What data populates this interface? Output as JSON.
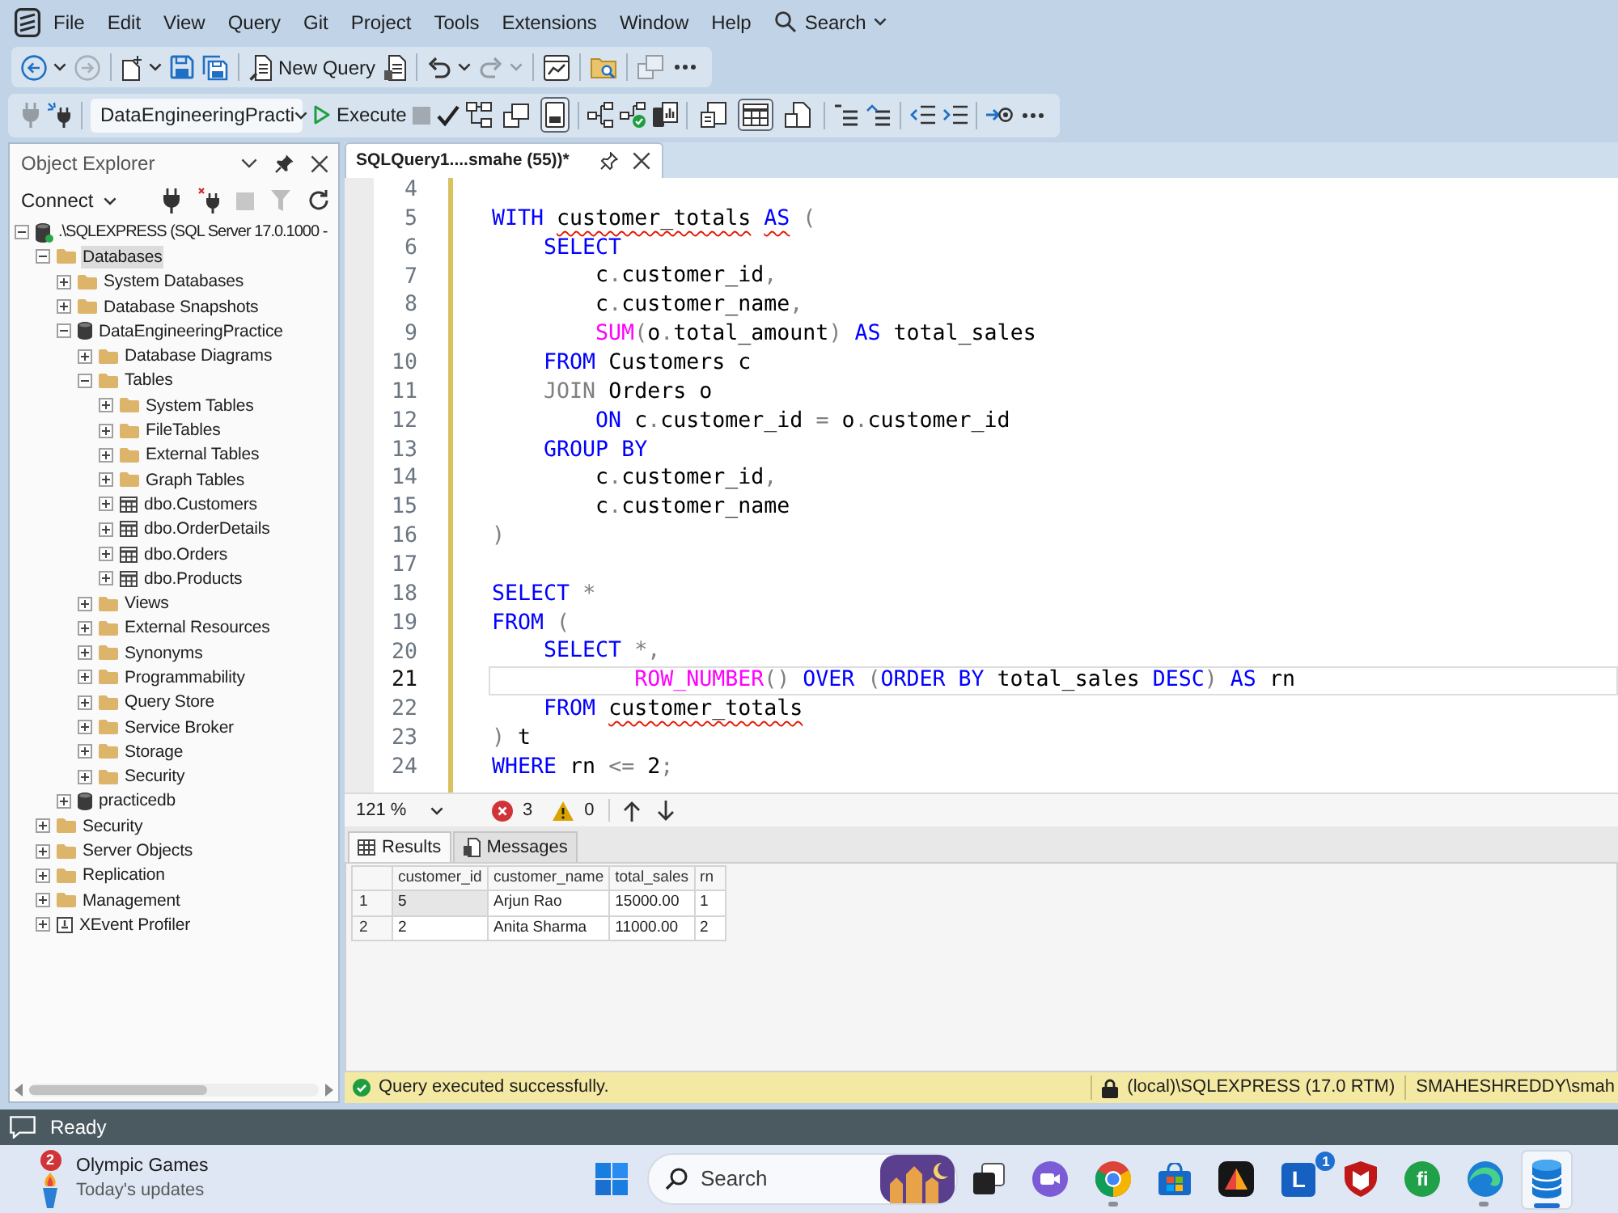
{
  "menu_bar": {
    "items": [
      "File",
      "Edit",
      "View",
      "Query",
      "Git",
      "Project",
      "Tools",
      "Extensions",
      "Window",
      "Help"
    ],
    "search": "Search"
  },
  "standard_toolbar": [
    {
      "kind": "split",
      "disabled": false
    },
    {
      "kind": "button",
      "disabled": true
    },
    {
      "kind": "separator"
    },
    {
      "kind": "split",
      "disabled": false
    },
    {
      "kind": "button",
      "disabled": false
    },
    {
      "kind": "button",
      "disabled": false
    },
    {
      "kind": "separator"
    },
    {
      "kind": "labeled",
      "label": "New Query",
      "disabled": false
    },
    {
      "kind": "button",
      "disabled": false
    },
    {
      "kind": "separator"
    },
    {
      "kind": "split",
      "disabled": false
    },
    {
      "kind": "split",
      "disabled": true
    },
    {
      "kind": "separator"
    },
    {
      "kind": "button",
      "disabled": false
    },
    {
      "kind": "separator"
    },
    {
      "kind": "button",
      "disabled": false
    },
    {
      "kind": "separator"
    },
    {
      "kind": "button",
      "disabled": true
    },
    {
      "kind": "overflow"
    }
  ],
  "sql_toolbar": [
    {
      "kind": "button",
      "disabled": true
    },
    {
      "kind": "button",
      "disabled": false
    },
    {
      "kind": "separator"
    },
    {
      "kind": "combo",
      "value": "DataEngineeringPracti"
    },
    {
      "kind": "labeled",
      "label": "Execute",
      "disabled": false
    },
    {
      "kind": "button",
      "disabled": true
    },
    {
      "kind": "button",
      "disabled": false
    },
    {
      "kind": "button",
      "disabled": false
    },
    {
      "kind": "toggle",
      "on": false,
      "disabled": false
    },
    {
      "kind": "toggle",
      "on": true,
      "disabled": false
    },
    {
      "kind": "separator"
    },
    {
      "kind": "button",
      "disabled": false
    },
    {
      "kind": "button",
      "disabled": false
    },
    {
      "kind": "button",
      "disabled": false
    },
    {
      "kind": "separator"
    },
    {
      "kind": "toggle",
      "on": false,
      "disabled": false
    },
    {
      "kind": "toggle",
      "on": true,
      "disabled": false
    },
    {
      "kind": "toggle",
      "on": false,
      "disabled": false
    },
    {
      "kind": "separator"
    },
    {
      "kind": "button",
      "disabled": false
    },
    {
      "kind": "button",
      "disabled": false
    },
    {
      "kind": "separator"
    },
    {
      "kind": "button",
      "disabled": false
    },
    {
      "kind": "button",
      "disabled": false
    },
    {
      "kind": "separator"
    },
    {
      "kind": "button",
      "disabled": false
    },
    {
      "kind": "overflow"
    }
  ],
  "object_explorer": {
    "title": "Object Explorer",
    "connect": "Connect",
    "tools": [
      {
        "disabled": false
      },
      {
        "disabled": false
      },
      {
        "disabled": true
      },
      {
        "disabled": true
      },
      {
        "disabled": false
      }
    ],
    "tree": [
      {
        "label": ".\\SQLEXPRESS (SQL Server 17.0.1000 -",
        "kind": "server",
        "expanded": true,
        "selected": false,
        "children": [
          {
            "label": "Databases",
            "kind": "folder",
            "expanded": true,
            "selected": true,
            "children": [
              {
                "label": "System Databases",
                "kind": "folder",
                "expanded": false,
                "selected": false
              },
              {
                "label": "Database Snapshots",
                "kind": "folder",
                "expanded": false,
                "selected": false
              },
              {
                "label": "DataEngineeringPractice",
                "kind": "database",
                "expanded": true,
                "selected": false,
                "children": [
                  {
                    "label": "Database Diagrams",
                    "kind": "folder",
                    "expanded": false,
                    "selected": false
                  },
                  {
                    "label": "Tables",
                    "kind": "folder",
                    "expanded": true,
                    "selected": false,
                    "children": [
                      {
                        "label": "System Tables",
                        "kind": "folder",
                        "expanded": false,
                        "selected": false
                      },
                      {
                        "label": "FileTables",
                        "kind": "folder",
                        "expanded": false,
                        "selected": false
                      },
                      {
                        "label": "External Tables",
                        "kind": "folder",
                        "expanded": false,
                        "selected": false
                      },
                      {
                        "label": "Graph Tables",
                        "kind": "folder",
                        "expanded": false,
                        "selected": false
                      },
                      {
                        "label": "dbo.Customers",
                        "kind": "table",
                        "expanded": false,
                        "selected": false
                      },
                      {
                        "label": "dbo.OrderDetails",
                        "kind": "table",
                        "expanded": false,
                        "selected": false
                      },
                      {
                        "label": "dbo.Orders",
                        "kind": "table",
                        "expanded": false,
                        "selected": false
                      },
                      {
                        "label": "dbo.Products",
                        "kind": "table",
                        "expanded": false,
                        "selected": false
                      }
                    ]
                  },
                  {
                    "label": "Views",
                    "kind": "folder",
                    "expanded": false,
                    "selected": false
                  },
                  {
                    "label": "External Resources",
                    "kind": "folder",
                    "expanded": false,
                    "selected": false
                  },
                  {
                    "label": "Synonyms",
                    "kind": "folder",
                    "expanded": false,
                    "selected": false
                  },
                  {
                    "label": "Programmability",
                    "kind": "folder",
                    "expanded": false,
                    "selected": false
                  },
                  {
                    "label": "Query Store",
                    "kind": "folder",
                    "expanded": false,
                    "selected": false
                  },
                  {
                    "label": "Service Broker",
                    "kind": "folder",
                    "expanded": false,
                    "selected": false
                  },
                  {
                    "label": "Storage",
                    "kind": "folder",
                    "expanded": false,
                    "selected": false
                  },
                  {
                    "label": "Security",
                    "kind": "folder",
                    "expanded": false,
                    "selected": false
                  }
                ]
              },
              {
                "label": "practicedb",
                "kind": "database",
                "expanded": false,
                "selected": false
              }
            ]
          },
          {
            "label": "Security",
            "kind": "folder",
            "expanded": false,
            "selected": false
          },
          {
            "label": "Server Objects",
            "kind": "folder",
            "expanded": false,
            "selected": false
          },
          {
            "label": "Replication",
            "kind": "folder",
            "expanded": false,
            "selected": false
          },
          {
            "label": "Management",
            "kind": "folder",
            "expanded": false,
            "selected": false
          },
          {
            "label": "XEvent Profiler",
            "kind": "profiler",
            "expanded": false,
            "selected": false
          }
        ]
      }
    ]
  },
  "editor": {
    "tabs": [
      {
        "title": "SQLQuery1....smahe (55))*",
        "selected": true
      }
    ],
    "lines": [
      {
        "number": "4",
        "current": false
      },
      {
        "number": "5",
        "current": false,
        "tokens": [
          {
            "text": "WITH ",
            "kind": "keyword",
            "error": false
          },
          {
            "text": "customer_totals",
            "kind": "plain",
            "error": true
          },
          {
            "text": " AS",
            "kind": "keyword",
            "error": true
          },
          {
            "text": " (",
            "kind": "operator",
            "error": false
          }
        ]
      },
      {
        "number": "6",
        "current": false,
        "tokens": [
          {
            "text": "    SELECT",
            "kind": "keyword",
            "error": false
          }
        ]
      },
      {
        "number": "7",
        "current": false,
        "tokens": [
          {
            "text": "        c",
            "kind": "plain",
            "error": false
          },
          {
            "text": ".",
            "kind": "operator",
            "error": false
          },
          {
            "text": "customer_id",
            "kind": "plain",
            "error": false
          },
          {
            "text": ",",
            "kind": "operator",
            "error": false
          }
        ]
      },
      {
        "number": "8",
        "current": false,
        "tokens": [
          {
            "text": "        c",
            "kind": "plain",
            "error": false
          },
          {
            "text": ".",
            "kind": "operator",
            "error": false
          },
          {
            "text": "customer_name",
            "kind": "plain",
            "error": false
          },
          {
            "text": ",",
            "kind": "operator",
            "error": false
          }
        ]
      },
      {
        "number": "9",
        "current": false,
        "tokens": [
          {
            "text": "        SUM",
            "kind": "function",
            "error": false
          },
          {
            "text": "(",
            "kind": "operator",
            "error": false
          },
          {
            "text": "o",
            "kind": "plain",
            "error": false
          },
          {
            "text": ".",
            "kind": "operator",
            "error": false
          },
          {
            "text": "total_amount",
            "kind": "plain",
            "error": false
          },
          {
            "text": ")",
            "kind": "operator",
            "error": false
          },
          {
            "text": " AS",
            "kind": "keyword",
            "error": false
          },
          {
            "text": " total_sales",
            "kind": "plain",
            "error": false
          }
        ]
      },
      {
        "number": "10",
        "current": false,
        "tokens": [
          {
            "text": "    FROM",
            "kind": "keyword",
            "error": false
          },
          {
            "text": " Customers c",
            "kind": "plain",
            "error": false
          }
        ]
      },
      {
        "number": "11",
        "current": false,
        "tokens": [
          {
            "text": "    JOIN",
            "kind": "operator",
            "error": false
          },
          {
            "text": " Orders o",
            "kind": "plain",
            "error": false
          }
        ]
      },
      {
        "number": "12",
        "current": false,
        "tokens": [
          {
            "text": "        ON",
            "kind": "keyword",
            "error": false
          },
          {
            "text": " c",
            "kind": "plain",
            "error": false
          },
          {
            "text": ".",
            "kind": "operator",
            "error": false
          },
          {
            "text": "customer_id ",
            "kind": "plain",
            "error": false
          },
          {
            "text": "=",
            "kind": "operator",
            "error": false
          },
          {
            "text": " o",
            "kind": "plain",
            "error": false
          },
          {
            "text": ".",
            "kind": "operator",
            "error": false
          },
          {
            "text": "customer_id",
            "kind": "plain",
            "error": false
          }
        ]
      },
      {
        "number": "13",
        "current": false,
        "tokens": [
          {
            "text": "    GROUP BY",
            "kind": "keyword",
            "error": false
          }
        ]
      },
      {
        "number": "14",
        "current": false,
        "tokens": [
          {
            "text": "        c",
            "kind": "plain",
            "error": false
          },
          {
            "text": ".",
            "kind": "operator",
            "error": false
          },
          {
            "text": "customer_id",
            "kind": "plain",
            "error": false
          },
          {
            "text": ",",
            "kind": "operator",
            "error": false
          }
        ]
      },
      {
        "number": "15",
        "current": false,
        "tokens": [
          {
            "text": "        c",
            "kind": "plain",
            "error": false
          },
          {
            "text": ".",
            "kind": "operator",
            "error": false
          },
          {
            "text": "customer_name",
            "kind": "plain",
            "error": false
          }
        ]
      },
      {
        "number": "16",
        "current": false,
        "tokens": [
          {
            "text": ")",
            "kind": "operator",
            "error": false
          }
        ]
      },
      {
        "number": "17",
        "current": false
      },
      {
        "number": "18",
        "current": false,
        "tokens": [
          {
            "text": "SELECT",
            "kind": "keyword",
            "error": false
          },
          {
            "text": " *",
            "kind": "operator",
            "error": false
          }
        ]
      },
      {
        "number": "19",
        "current": false,
        "tokens": [
          {
            "text": "FROM",
            "kind": "keyword",
            "error": false
          },
          {
            "text": " (",
            "kind": "operator",
            "error": false
          }
        ]
      },
      {
        "number": "20",
        "current": false,
        "tokens": [
          {
            "text": "    SELECT",
            "kind": "keyword",
            "error": false
          },
          {
            "text": " *,",
            "kind": "operator",
            "error": false
          }
        ]
      },
      {
        "number": "21",
        "current": true,
        "tokens": [
          {
            "text": "           ROW_NUMBER",
            "kind": "function",
            "error": false
          },
          {
            "text": "()",
            "kind": "operator",
            "error": false
          },
          {
            "text": " OVER",
            "kind": "keyword",
            "error": false
          },
          {
            "text": " (",
            "kind": "operator",
            "error": false
          },
          {
            "text": "ORDER BY",
            "kind": "keyword",
            "error": false
          },
          {
            "text": " total_sales ",
            "kind": "plain",
            "error": false
          },
          {
            "text": "DESC",
            "kind": "keyword",
            "error": false
          },
          {
            "text": ")",
            "kind": "operator",
            "error": false
          },
          {
            "text": " AS",
            "kind": "keyword",
            "error": false
          },
          {
            "text": " rn",
            "kind": "plain",
            "error": false
          }
        ]
      },
      {
        "number": "22",
        "current": false,
        "tokens": [
          {
            "text": "    FROM",
            "kind": "keyword",
            "error": false
          },
          {
            "text": " customer_totals",
            "kind": "plain",
            "error": true
          }
        ]
      },
      {
        "number": "23",
        "current": false,
        "tokens": [
          {
            "text": ")",
            "kind": "operator",
            "error": false
          },
          {
            "text": " t",
            "kind": "plain",
            "error": false
          }
        ]
      },
      {
        "number": "24",
        "current": false,
        "tokens": [
          {
            "text": "WHERE",
            "kind": "keyword",
            "error": false
          },
          {
            "text": " rn ",
            "kind": "plain",
            "error": false
          },
          {
            "text": "<=",
            "kind": "operator",
            "error": false
          },
          {
            "text": " 2",
            "kind": "plain",
            "error": false
          },
          {
            "text": ";",
            "kind": "operator",
            "error": false
          }
        ]
      }
    ],
    "zoom": "121 %",
    "errors": "3",
    "warnings": "0"
  },
  "results": {
    "tabs": [
      {
        "label": "Results",
        "selected": true
      },
      {
        "label": "Messages",
        "selected": false
      }
    ],
    "columns": [
      "customer_id",
      "customer_name",
      "total_sales",
      "rn"
    ],
    "rows": [
      {
        "number": "1",
        "cells": [
          {
            "value": "5",
            "focused": true
          },
          {
            "value": "Arjun Rao",
            "focused": false
          },
          {
            "value": "15000.00",
            "focused": false
          },
          {
            "value": "1",
            "focused": false
          }
        ]
      },
      {
        "number": "2",
        "cells": [
          {
            "value": "2",
            "focused": false
          },
          {
            "value": "Anita Sharma",
            "focused": false
          },
          {
            "value": "11000.00",
            "focused": false
          },
          {
            "value": "2",
            "focused": false
          }
        ]
      }
    ]
  },
  "query_status": {
    "message": "Query executed successfully.",
    "server": "(local)\\SQLEXPRESS (17.0 RTM)",
    "user": "SMAHESHREDDY\\smah"
  },
  "status_bar": {
    "text": "Ready"
  },
  "taskbar": {
    "widget": {
      "badge": "2",
      "title": "Olympic Games",
      "subtitle": "Today's updates"
    },
    "search": {
      "placeholder": "Search"
    },
    "apps": [
      {
        "kind": "icon",
        "running": false,
        "active": false
      },
      {
        "kind": "icon",
        "running": false,
        "active": false
      },
      {
        "kind": "icon",
        "running": true,
        "active": false
      },
      {
        "kind": "icon",
        "running": false,
        "active": false
      },
      {
        "kind": "icon",
        "running": false,
        "active": false
      },
      {
        "kind": "letter_tile",
        "glyph": "L",
        "badge": "1",
        "running": false,
        "active": false
      },
      {
        "kind": "icon",
        "running": false,
        "active": false
      },
      {
        "kind": "letter_circle",
        "glyph": "fi",
        "running": false,
        "active": false
      },
      {
        "kind": "icon",
        "running": true,
        "active": false
      },
      {
        "kind": "icon",
        "running": true,
        "active": true
      }
    ]
  }
}
